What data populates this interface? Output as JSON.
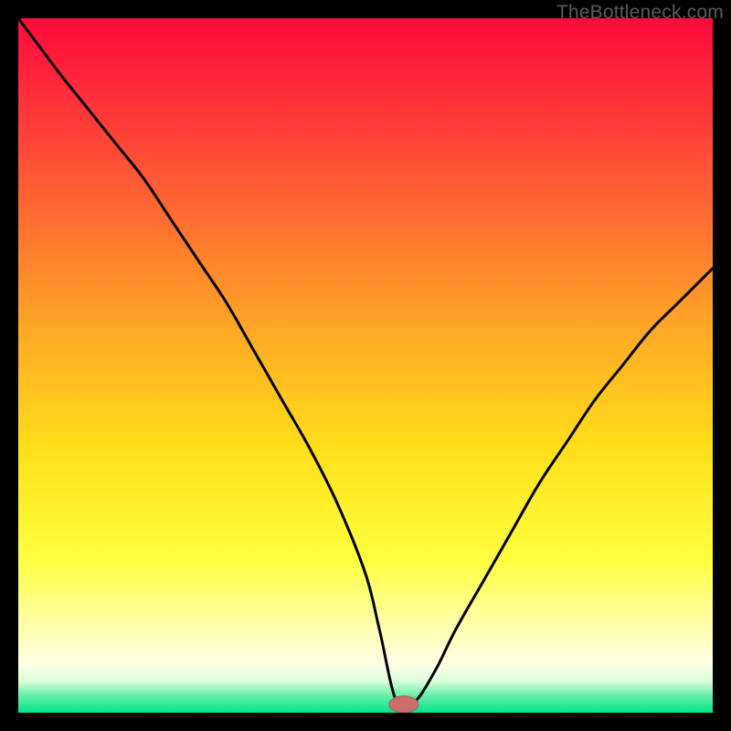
{
  "attribution": "TheBottleneck.com",
  "colors": {
    "gradient_stops": [
      {
        "offset": 0.0,
        "color": "#ff0a3a"
      },
      {
        "offset": 0.1,
        "color": "#ff2a3a"
      },
      {
        "offset": 0.28,
        "color": "#ff6a32"
      },
      {
        "offset": 0.45,
        "color": "#ffa826"
      },
      {
        "offset": 0.62,
        "color": "#ffdf1a"
      },
      {
        "offset": 0.78,
        "color": "#ffff40"
      },
      {
        "offset": 0.88,
        "color": "#ffffb0"
      },
      {
        "offset": 0.93,
        "color": "#ffffe8"
      },
      {
        "offset": 0.955,
        "color": "#d8ffd8"
      },
      {
        "offset": 0.975,
        "color": "#66f0a8"
      },
      {
        "offset": 1.0,
        "color": "#00e68a"
      }
    ],
    "curve": "#000000",
    "marker_fill": "#cc6e6a",
    "marker_stroke": "#b85a56",
    "frame": "#000000"
  },
  "chart_data": {
    "type": "line",
    "title": "",
    "xlabel": "",
    "ylabel": "",
    "xlim": [
      0,
      100
    ],
    "ylim": [
      0,
      100
    ],
    "grid": false,
    "legend": false,
    "series": [
      {
        "name": "bottleneck-curve",
        "x": [
          0,
          3,
          6,
          10,
          14,
          18,
          22,
          26,
          30,
          34,
          38,
          42,
          46,
          50,
          52,
          54.5,
          57,
          60,
          63,
          67,
          71,
          75,
          79,
          83,
          87,
          91,
          95,
          100
        ],
        "y": [
          100,
          96,
          92,
          87,
          82,
          77,
          71,
          65,
          59,
          52,
          45,
          38,
          30,
          20,
          12,
          1.5,
          1.5,
          6,
          12,
          19,
          26,
          33,
          39,
          45,
          50,
          55,
          59,
          64
        ]
      }
    ],
    "marker": {
      "x": 55.5,
      "y": 1.2,
      "rx": 2.1,
      "ry": 1.2
    }
  }
}
